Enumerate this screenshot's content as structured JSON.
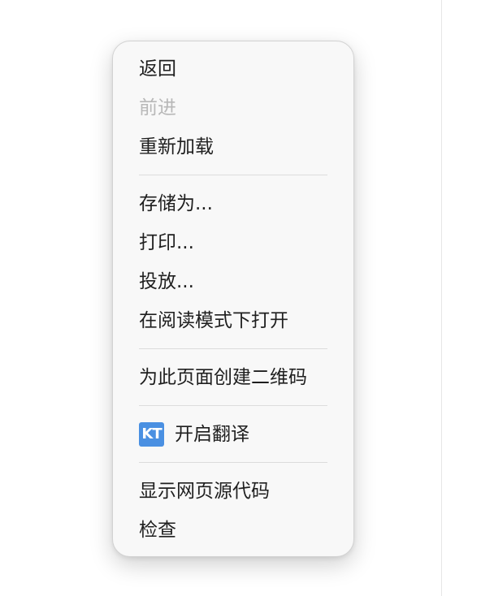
{
  "context_menu": {
    "group1": {
      "back": "返回",
      "forward": "前进",
      "reload": "重新加载"
    },
    "group2": {
      "save_as": "存储为...",
      "print": "打印...",
      "cast": "投放...",
      "reader_mode": "在阅读模式下打开"
    },
    "group3": {
      "qr_code": "为此页面创建二维码"
    },
    "group4": {
      "translate_icon_text": "KT",
      "translate": "开启翻译"
    },
    "group5": {
      "view_source": "显示网页源代码",
      "inspect": "检查"
    }
  },
  "colors": {
    "menu_background": "#f8f8f8",
    "text": "#1f1f1f",
    "disabled_text": "#b8b8b8",
    "icon_blue": "#4a90e2"
  }
}
